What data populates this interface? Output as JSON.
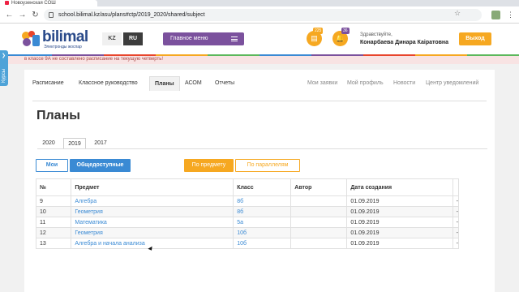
{
  "browser": {
    "tab_title": "Новоузенская СОШ",
    "url": "school.bilimal.kz/asu/plans#ctp/2019_2020/shared/subject",
    "icons": [
      "back-icon",
      "forward-icon",
      "reload-icon",
      "lock-icon",
      "star-icon",
      "extension-icon",
      "menu-icon"
    ]
  },
  "header": {
    "logo_text": "bilimal",
    "logo_subtitle": "Электронды жоспар",
    "lang_kz": "KZ",
    "lang_ru": "RU",
    "main_menu_label": "Главное меню",
    "notifications": [
      {
        "icon": "document-icon",
        "count": "225"
      },
      {
        "icon": "bell-icon",
        "count": "36"
      }
    ],
    "greeting": "Здравствуйте,",
    "user_name": "Конарбаева Динара Каіратовна",
    "exit_label": "Выход",
    "strip_colors": [
      "#3a8ad4",
      "#7b519d",
      "#e8452c",
      "#f6a821",
      "#5cb85c",
      "#3a8ad4",
      "#7b519d",
      "#e8452c",
      "#f6a821",
      "#5cb85c"
    ]
  },
  "alert_text": "в классе 9А не составлено расписание на текущую четверть!",
  "side_tab_label": "Курсы",
  "subnav": {
    "left": [
      "Расписание",
      "Классное руководство",
      "Планы",
      "АСОМ",
      "Отчеты"
    ],
    "active": "Планы",
    "right": [
      "Мои заявки",
      "Мой профиль",
      "Новости",
      "Центр уведомлений"
    ]
  },
  "page_title": "Планы",
  "year_tabs": [
    "2020",
    "2019",
    "2017"
  ],
  "active_year": "2019",
  "buttons": {
    "mine": "Мои",
    "public": "Общедоступные",
    "by_subject": "По предмету",
    "by_parallel": "По параллелям"
  },
  "table": {
    "headers": [
      "№",
      "Предмет",
      "Класс",
      "Автор",
      "Дата создания",
      ""
    ],
    "rows": [
      {
        "num": "9",
        "subject": "Алгебра",
        "class": "8б",
        "author": "",
        "date": "01.09.2019",
        "action": "-"
      },
      {
        "num": "10",
        "subject": "Геометрия",
        "class": "8б",
        "author": "",
        "date": "01.09.2019",
        "action": "-"
      },
      {
        "num": "11",
        "subject": "Математика",
        "class": "5а",
        "author": "",
        "date": "01.09.2019",
        "action": "-"
      },
      {
        "num": "12",
        "subject": "Геометрия",
        "class": "10б",
        "author": "",
        "date": "01.09.2019",
        "action": "-"
      },
      {
        "num": "13",
        "subject": "Алгебра и начала анализа",
        "class": "10б",
        "author": "",
        "date": "01.09.2019",
        "action": "-"
      }
    ]
  }
}
